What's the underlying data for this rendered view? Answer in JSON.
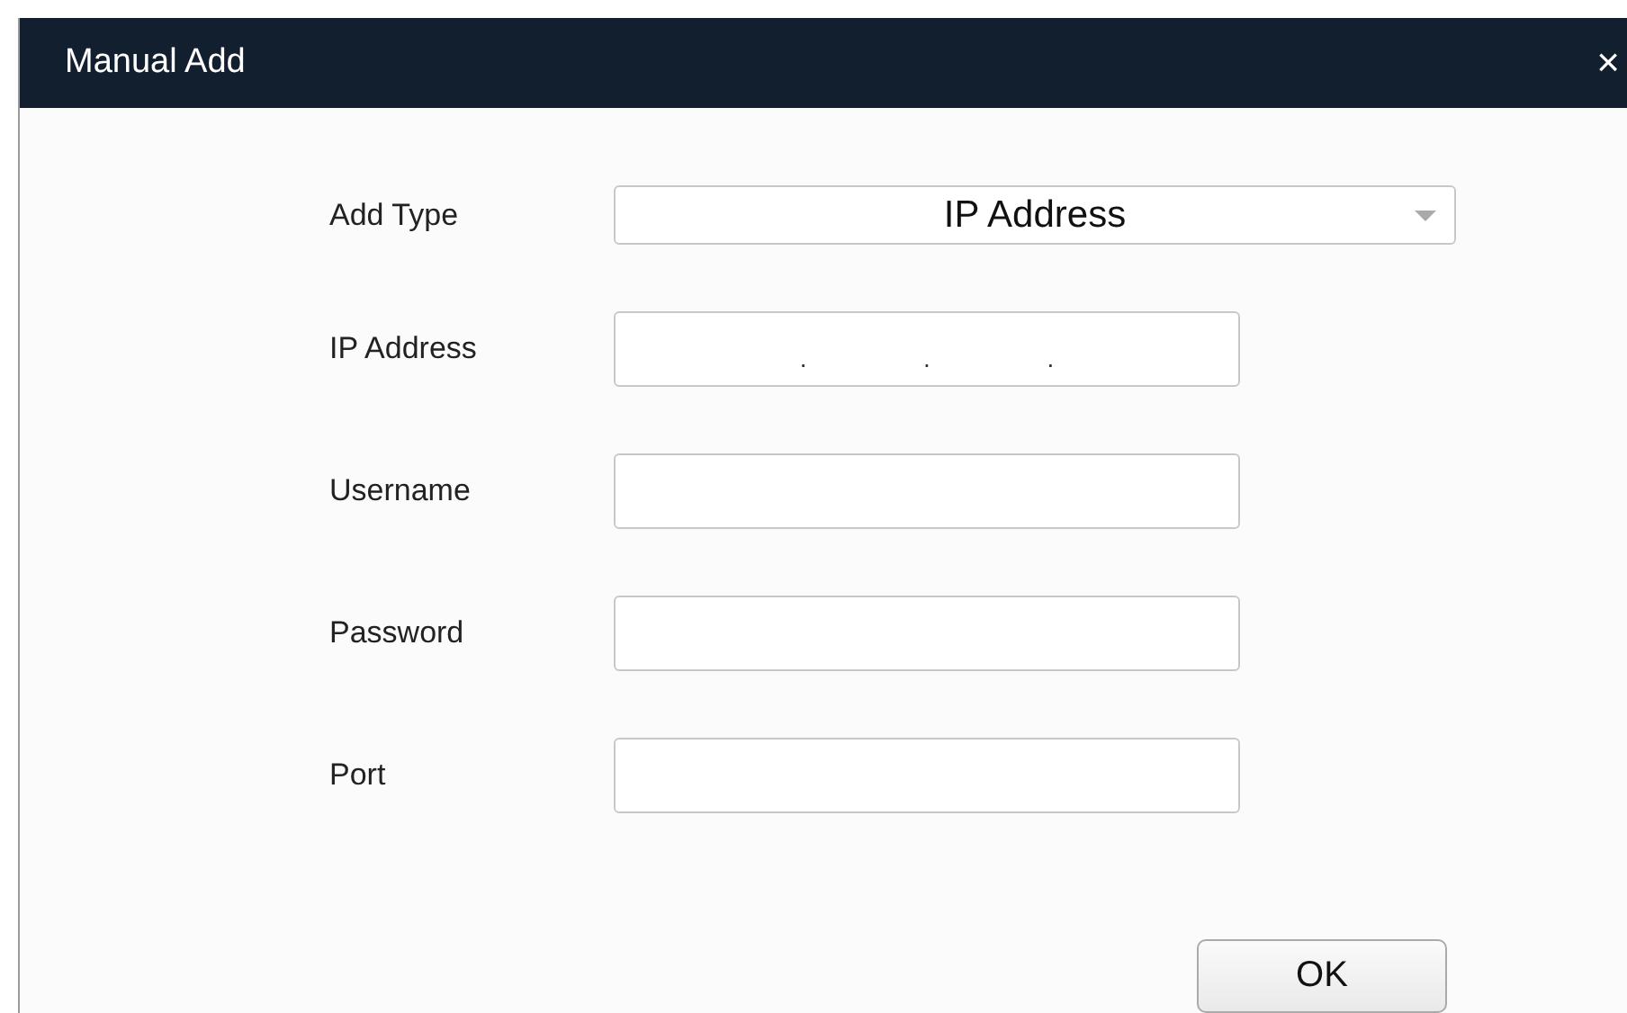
{
  "dialog": {
    "title": "Manual Add",
    "close": "×"
  },
  "fields": [
    {
      "kind": "select",
      "label": "Add Type",
      "value": "IP Address"
    },
    {
      "kind": "ip",
      "label": "IP Address",
      "separators": [
        ".",
        ".",
        "."
      ]
    },
    {
      "kind": "text",
      "label": "Username"
    },
    {
      "kind": "text",
      "label": "Password"
    },
    {
      "kind": "text",
      "label": "Port"
    }
  ],
  "buttons": [
    "OK"
  ]
}
